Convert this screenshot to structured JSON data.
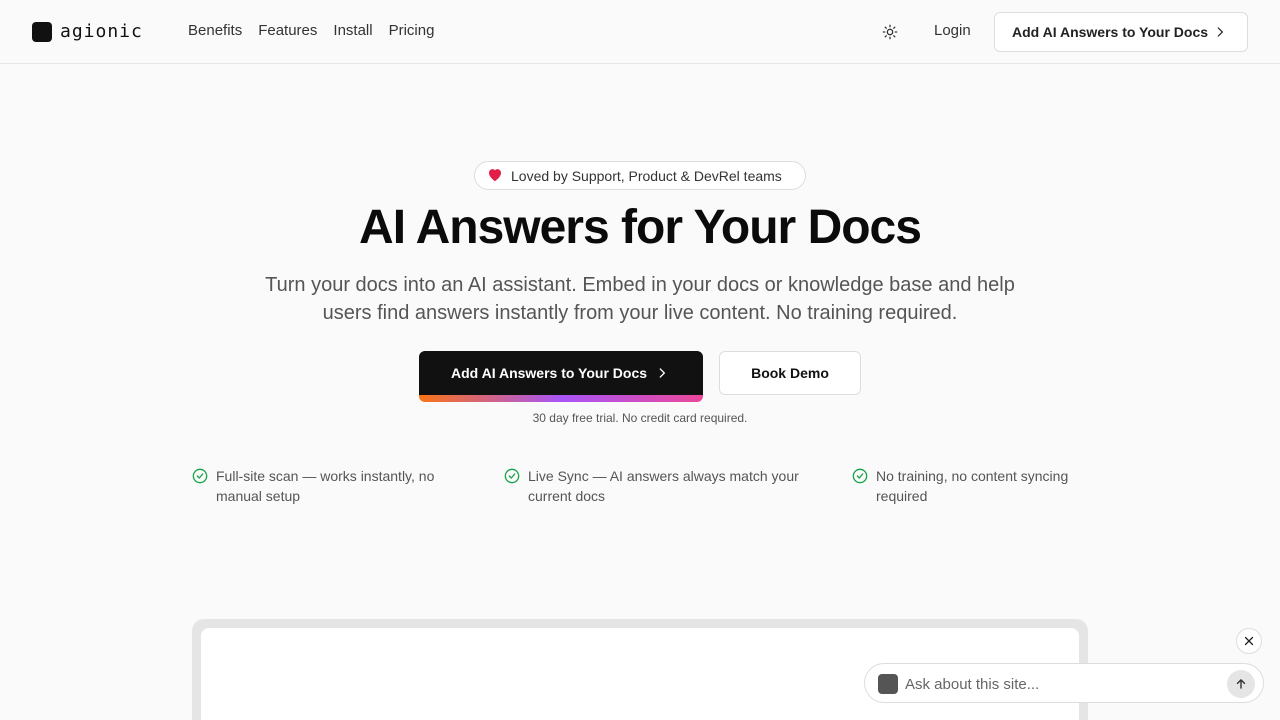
{
  "header": {
    "brand": "agionic",
    "nav": [
      "Benefits",
      "Features",
      "Install",
      "Pricing"
    ],
    "login_label": "Login",
    "cta_label": "Add AI Answers to Your Docs"
  },
  "hero": {
    "badge_text": "Loved by Support, Product & DevRel teams",
    "headline": "AI Answers for Your Docs",
    "subhead": "Turn your docs into an AI assistant. Embed in your docs or knowledge base and help users find answers instantly from your live content. No training required.",
    "primary_cta": "Add AI Answers to Your Docs",
    "secondary_cta": "Book Demo",
    "trial_note": "30 day free trial. No credit card required."
  },
  "features": [
    "Full-site scan — works instantly, no manual setup",
    "Live Sync — AI answers always match your current docs",
    "No training, no content syncing required"
  ],
  "chat_widget": {
    "placeholder": "Ask about this site..."
  },
  "colors": {
    "accent_check": "#16a34a",
    "heart": "#e11d48",
    "primary_button": "#111111"
  }
}
